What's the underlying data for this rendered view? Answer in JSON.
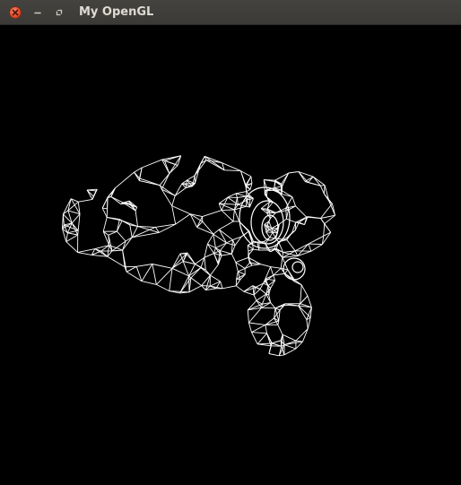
{
  "window": {
    "title": "My OpenGL",
    "controls": {
      "close_icon": "close-icon",
      "minimize_icon": "minimize-icon",
      "maximize_icon": "maximize-icon"
    }
  },
  "viewport": {
    "background": "#000000",
    "model": "suzanne-monkey-head",
    "render_mode": "wireframe",
    "line_color": "#ffffff"
  }
}
